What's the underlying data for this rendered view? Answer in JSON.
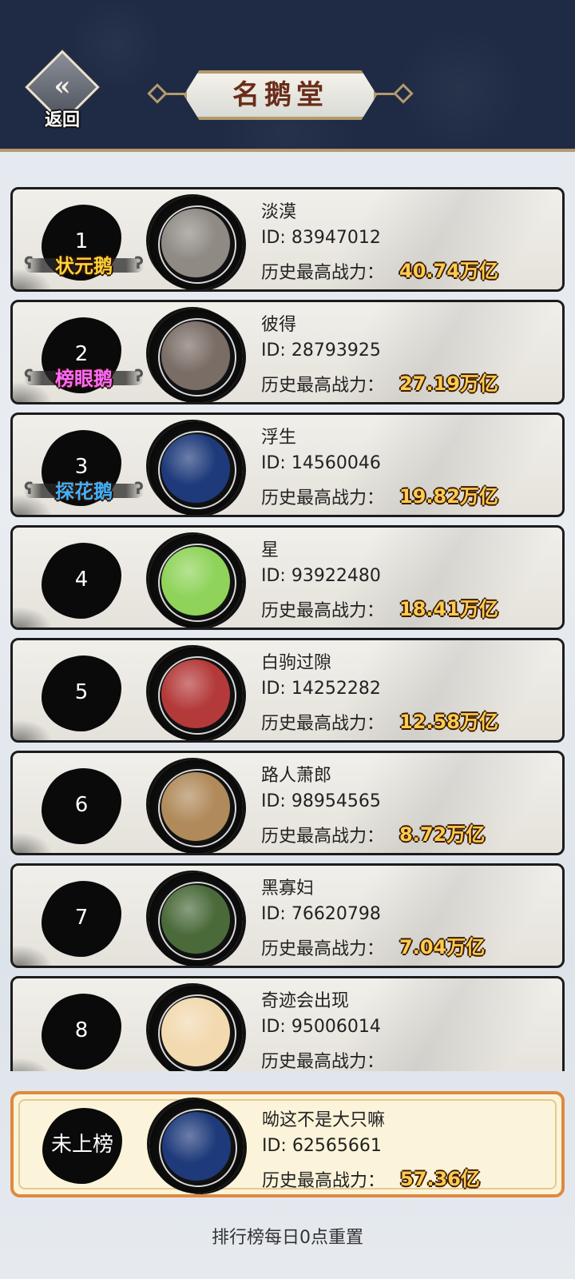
{
  "header": {
    "back_label": "返回",
    "title": "名鹅堂"
  },
  "ranking": [
    {
      "rank": "1",
      "title": "状元鹅",
      "title_color": "#ffd23a",
      "name": "淡漠",
      "id": "ID: 83947012",
      "power_label": "历史最高战力：",
      "power": "40.74万亿",
      "avatar_color": "#8f8a84"
    },
    {
      "rank": "2",
      "title": "榜眼鹅",
      "title_color": "#ff6bff",
      "name": "彼得",
      "id": "ID: 28793925",
      "power_label": "历史最高战力：",
      "power": "27.19万亿",
      "avatar_color": "#7a6d66"
    },
    {
      "rank": "3",
      "title": "探花鹅",
      "title_color": "#3fb2ff",
      "name": "浮生",
      "id": "ID: 14560046",
      "power_label": "历史最高战力：",
      "power": "19.82万亿",
      "avatar_color": "#1e3a7a"
    },
    {
      "rank": "4",
      "title": "",
      "title_color": "",
      "name": "星",
      "id": "ID: 93922480",
      "power_label": "历史最高战力：",
      "power": "18.41万亿",
      "avatar_color": "#8fd35a"
    },
    {
      "rank": "5",
      "title": "",
      "title_color": "",
      "name": "白驹过隙",
      "id": "ID: 14252282",
      "power_label": "历史最高战力：",
      "power": "12.58万亿",
      "avatar_color": "#b43a3a"
    },
    {
      "rank": "6",
      "title": "",
      "title_color": "",
      "name": "路人萧郎",
      "id": "ID: 98954565",
      "power_label": "历史最高战力：",
      "power": "8.72万亿",
      "avatar_color": "#b08a5a"
    },
    {
      "rank": "7",
      "title": "",
      "title_color": "",
      "name": "黑寡妇",
      "id": "ID: 76620798",
      "power_label": "历史最高战力：",
      "power": "7.04万亿",
      "avatar_color": "#4a6a3a"
    },
    {
      "rank": "8",
      "title": "",
      "title_color": "",
      "name": "奇迹会出现",
      "id": "ID: 95006014",
      "power_label": "历史最高战力：",
      "power": "",
      "avatar_color": "#f2d9b0"
    }
  ],
  "my_rank": {
    "rank": "未上榜",
    "name": "呦这不是大只嘛",
    "id": "ID: 62565661",
    "power_label": "历史最高战力：",
    "power": "57.36亿",
    "avatar_color": "#1e3a7a"
  },
  "footer": {
    "note": "排行榜每日0点重置"
  },
  "colors": {
    "header_bg": "#1f2a44",
    "title_text": "#6b2c1a",
    "power_gold": "#ffcb50",
    "my_card_border": "#de8a3e"
  }
}
